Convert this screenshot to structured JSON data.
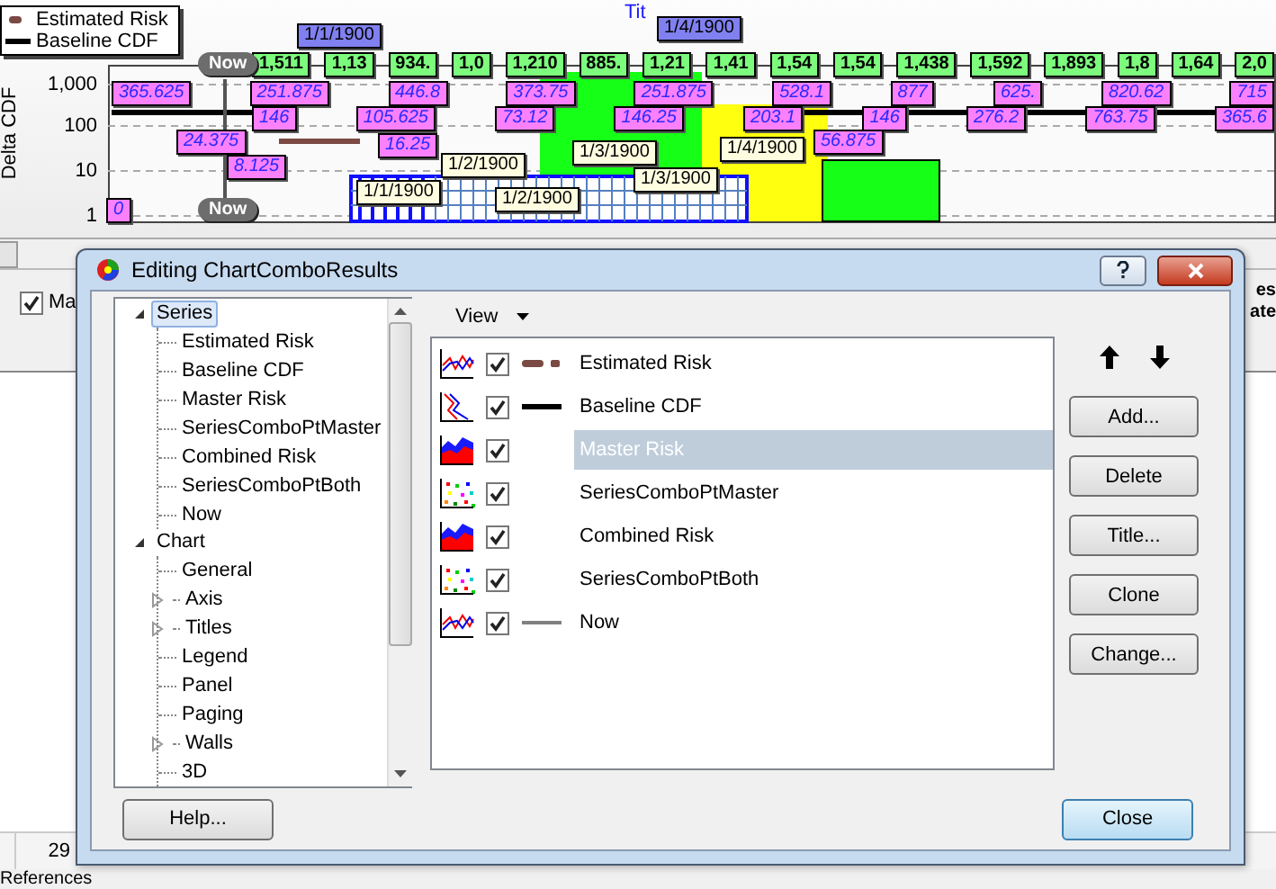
{
  "chart": {
    "title": "Tit",
    "legend": [
      {
        "label": "Estimated Risk",
        "kind": "dashed",
        "color": "#7b4a44"
      },
      {
        "label": "Baseline CDF",
        "kind": "solid",
        "color": "#000000"
      }
    ],
    "y_axis_label": "Delta CDF",
    "y_ticks": [
      "1,000",
      "100",
      "10",
      "1"
    ],
    "now_markers": [
      "Now",
      "Now"
    ],
    "data_labels": [
      {
        "text": "1/1/1900",
        "kind": "period"
      },
      {
        "text": "1/4/1900",
        "kind": "period"
      },
      {
        "text": "1,511",
        "kind": "total"
      },
      {
        "text": "1,13",
        "kind": "total"
      },
      {
        "text": "934.",
        "kind": "total"
      },
      {
        "text": "1,0",
        "kind": "total"
      },
      {
        "text": "1,210",
        "kind": "total"
      },
      {
        "text": "885.",
        "kind": "total"
      },
      {
        "text": "1,21",
        "kind": "total"
      },
      {
        "text": "1,41",
        "kind": "total"
      },
      {
        "text": "1,54",
        "kind": "total"
      },
      {
        "text": "1,54",
        "kind": "total"
      },
      {
        "text": "1,438",
        "kind": "total"
      },
      {
        "text": "1,592",
        "kind": "total"
      },
      {
        "text": "1,893",
        "kind": "total"
      },
      {
        "text": "1,8",
        "kind": "total"
      },
      {
        "text": "1,64",
        "kind": "total"
      },
      {
        "text": "2,0",
        "kind": "total"
      },
      {
        "text": "1/1/1900",
        "kind": "date"
      },
      {
        "text": "1/2/1900",
        "kind": "date"
      },
      {
        "text": "1/2/1900",
        "kind": "date"
      },
      {
        "text": "1/3/1900",
        "kind": "date"
      },
      {
        "text": "1/3/1900",
        "kind": "date"
      },
      {
        "text": "1/4/1900",
        "kind": "date"
      },
      {
        "text": "365.625",
        "kind": "value"
      },
      {
        "text": "146",
        "kind": "value"
      },
      {
        "text": "105.625",
        "kind": "value"
      },
      {
        "text": "251.875",
        "kind": "value"
      },
      {
        "text": "73.12",
        "kind": "value"
      },
      {
        "text": "146.25",
        "kind": "value"
      },
      {
        "text": "446.8",
        "kind": "value"
      },
      {
        "text": "373.75",
        "kind": "value"
      },
      {
        "text": "203.1",
        "kind": "value"
      },
      {
        "text": "146",
        "kind": "value"
      },
      {
        "text": "251.875",
        "kind": "value"
      },
      {
        "text": "276.2",
        "kind": "value"
      },
      {
        "text": "528.1",
        "kind": "value"
      },
      {
        "text": "877",
        "kind": "value"
      },
      {
        "text": "763.75",
        "kind": "value"
      },
      {
        "text": "365.6",
        "kind": "value"
      },
      {
        "text": "625.",
        "kind": "value"
      },
      {
        "text": "820.62",
        "kind": "value"
      },
      {
        "text": "715",
        "kind": "value"
      },
      {
        "text": "24.375",
        "kind": "value"
      },
      {
        "text": "8.125",
        "kind": "value"
      },
      {
        "text": "16.25",
        "kind": "value"
      },
      {
        "text": "56.875",
        "kind": "value"
      },
      {
        "text": "0",
        "kind": "value"
      }
    ]
  },
  "main_window": {
    "checkbox": {
      "label": "Ma",
      "checked": true
    },
    "side_texts": [
      "es",
      "ate"
    ],
    "cell": "29",
    "tab": "References"
  },
  "dialog": {
    "title": "Editing ChartComboResults",
    "tree": [
      {
        "label": "Series",
        "expanded": true,
        "selected": true,
        "children": [
          {
            "label": "Estimated Risk",
            "kind": "leaf",
            "selected": false
          },
          {
            "label": "Baseline CDF",
            "kind": "leaf",
            "selected": false
          },
          {
            "label": "Master Risk",
            "kind": "leaf",
            "selected": false
          },
          {
            "label": "SeriesComboPtMaster",
            "kind": "leaf",
            "selected": false
          },
          {
            "label": "Combined Risk",
            "kind": "leaf",
            "selected": false
          },
          {
            "label": "SeriesComboPtBoth",
            "kind": "leaf",
            "selected": false
          },
          {
            "label": "Now",
            "kind": "leaf",
            "selected": false
          }
        ]
      },
      {
        "label": "Chart",
        "expanded": true,
        "selected": false,
        "children": [
          {
            "label": "General",
            "kind": "leaf",
            "selected": false
          },
          {
            "label": "Axis",
            "kind": "collapsed",
            "selected": false
          },
          {
            "label": "Titles",
            "kind": "collapsed",
            "selected": false
          },
          {
            "label": "Legend",
            "kind": "leaf",
            "selected": false
          },
          {
            "label": "Panel",
            "kind": "leaf",
            "selected": false
          },
          {
            "label": "Paging",
            "kind": "leaf",
            "selected": false
          },
          {
            "label": "Walls",
            "kind": "collapsed",
            "selected": false
          },
          {
            "label": "3D",
            "kind": "leaf",
            "selected": false
          }
        ]
      }
    ],
    "view_menu": "View",
    "series": [
      {
        "label": "Estimated Risk",
        "kind": "trend",
        "visible": true,
        "selected": false
      },
      {
        "label": "Baseline CDF",
        "kind": "cdf",
        "visible": true,
        "selected": false
      },
      {
        "label": "Master Risk",
        "kind": "area",
        "visible": true,
        "selected": true
      },
      {
        "label": "SeriesComboPtMaster",
        "kind": "points",
        "visible": true,
        "selected": false
      },
      {
        "label": "Combined Risk",
        "kind": "area",
        "visible": true,
        "selected": false
      },
      {
        "label": "SeriesComboPtBoth",
        "kind": "points",
        "visible": true,
        "selected": false
      },
      {
        "label": "Now",
        "kind": "marker",
        "visible": true,
        "selected": false
      }
    ],
    "buttons": [
      "Add...",
      "Delete",
      "Title...",
      "Clone",
      "Change..."
    ],
    "help_button": "Help...",
    "close_button": "Close"
  }
}
